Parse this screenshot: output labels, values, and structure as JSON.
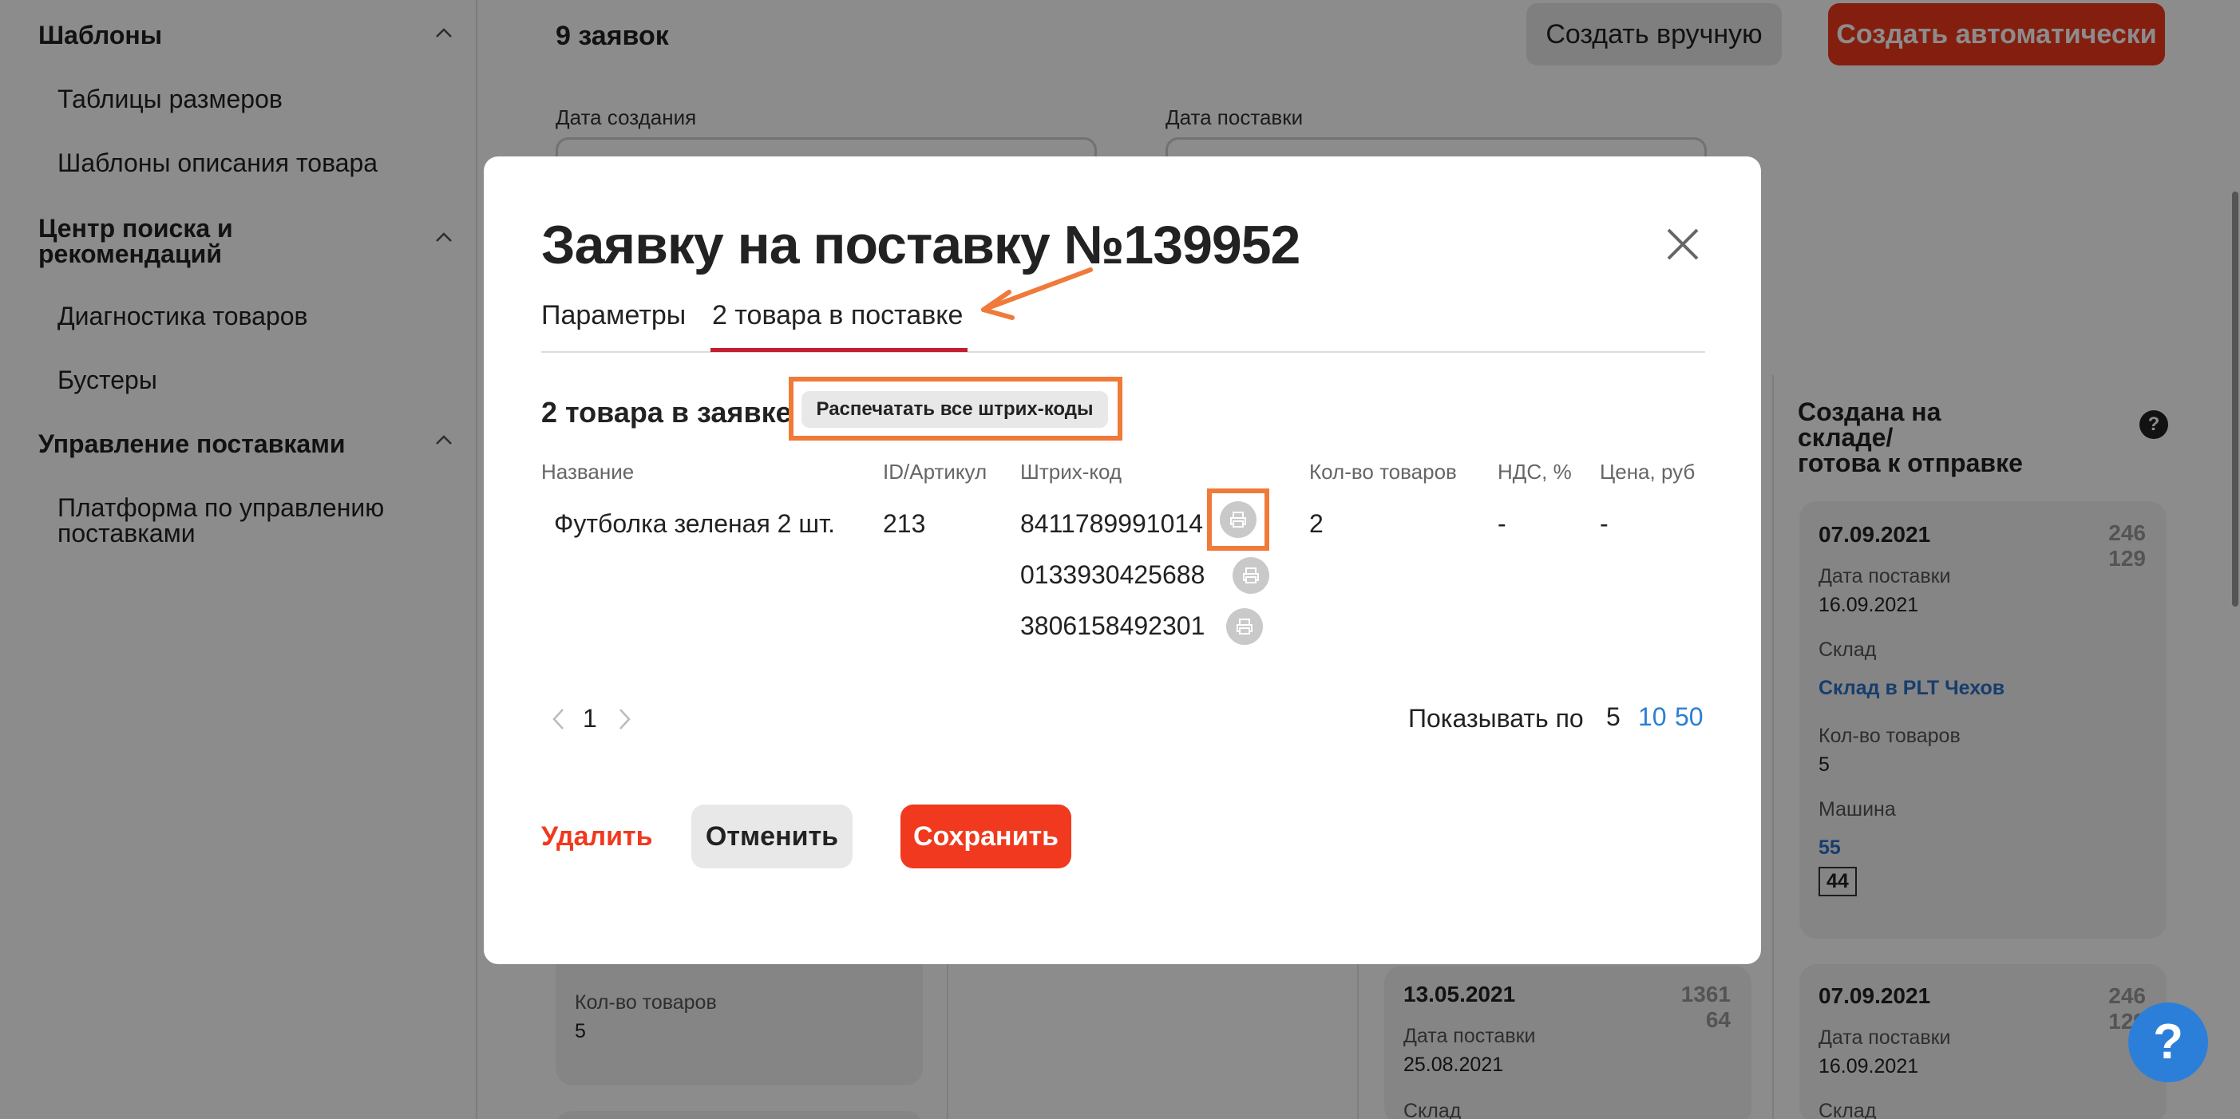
{
  "sidebar": {
    "groups": [
      {
        "label": "Шаблоны",
        "items": [
          "Таблицы размеров",
          "Шаблоны описания товара"
        ]
      },
      {
        "label": "Центр поиска и рекомендаций",
        "label_line1": "Центр поиска и",
        "label_line2": "рекомендаций",
        "items": [
          "Диагностика товаров",
          "Бустеры"
        ]
      },
      {
        "label": "Управление поставками",
        "items": [
          "Платформа по управлению поставками"
        ],
        "item_line1": "Платформа по управлению",
        "item_line2": "поставками"
      }
    ]
  },
  "header": {
    "count_title": "9 заявок",
    "create_manual": "Создать вручную",
    "create_auto": "Создать автоматически"
  },
  "filters": {
    "created_label": "Дата создания",
    "delivery_label": "Дата поставки"
  },
  "kanban": {
    "column_title_line1": "Создана на складе/",
    "column_title_line2": "готова к отправке",
    "help": "?",
    "cards": [
      {
        "date": "07.09.2021",
        "num_top": "246",
        "num_bottom": "129",
        "delivery_label": "Дата поставки",
        "delivery_date": "16.09.2021",
        "warehouse_label": "Склад",
        "warehouse": "Склад в PLT Чехов",
        "qty_label": "Кол-во товаров",
        "qty": "5",
        "car_label": "Машина",
        "car_link": "55",
        "car_badge": "44"
      },
      {
        "date": "07.09.2021",
        "num_top": "246",
        "num_bottom": "129",
        "delivery_label": "Дата поставки",
        "delivery_date": "16.09.2021",
        "warehouse_label": "Склад"
      },
      {
        "date": "13.05.2021",
        "num_top": "1361",
        "num_bottom": "64",
        "delivery_label": "Дата поставки",
        "delivery_date": "25.08.2021",
        "warehouse_label": "Склад"
      },
      {
        "qty_label": "Кол-во товаров",
        "qty": "5"
      }
    ]
  },
  "modal": {
    "title": "Заявку на поставку №139952",
    "tabs": [
      {
        "label": "Параметры",
        "active": false
      },
      {
        "label": "2 товара в поставке",
        "active": true
      }
    ],
    "section_title": "2 товара в заявке",
    "print_all": "Распечатать все штрих-коды",
    "columns": [
      "Название",
      "ID/Артикул",
      "Штрих-код",
      "Кол-во товаров",
      "НДС, %",
      "Цена, руб"
    ],
    "row": {
      "name": "Футболка зеленая 2 шт.",
      "id": "213",
      "barcodes": [
        "8411789991014",
        "0133930425688",
        "3806158492301"
      ],
      "qty": "2",
      "vat": "-",
      "price": "-"
    },
    "pagination": {
      "page": "1"
    },
    "show_per": {
      "label": "Показывать по",
      "options": [
        "5",
        "10",
        "50"
      ],
      "selected": "5"
    },
    "actions": {
      "delete": "Удалить",
      "cancel": "Отменить",
      "save": "Сохранить"
    }
  },
  "colors": {
    "accent": "#f0391e",
    "link": "#2a6fc7",
    "highlight": "#f07a3a",
    "tab_active": "#c21e2e"
  },
  "icons": [
    "chevron-up-icon",
    "close-icon",
    "printer-icon",
    "chevron-left-icon",
    "chevron-right-icon",
    "arrow-annotation-icon",
    "help-icon"
  ]
}
